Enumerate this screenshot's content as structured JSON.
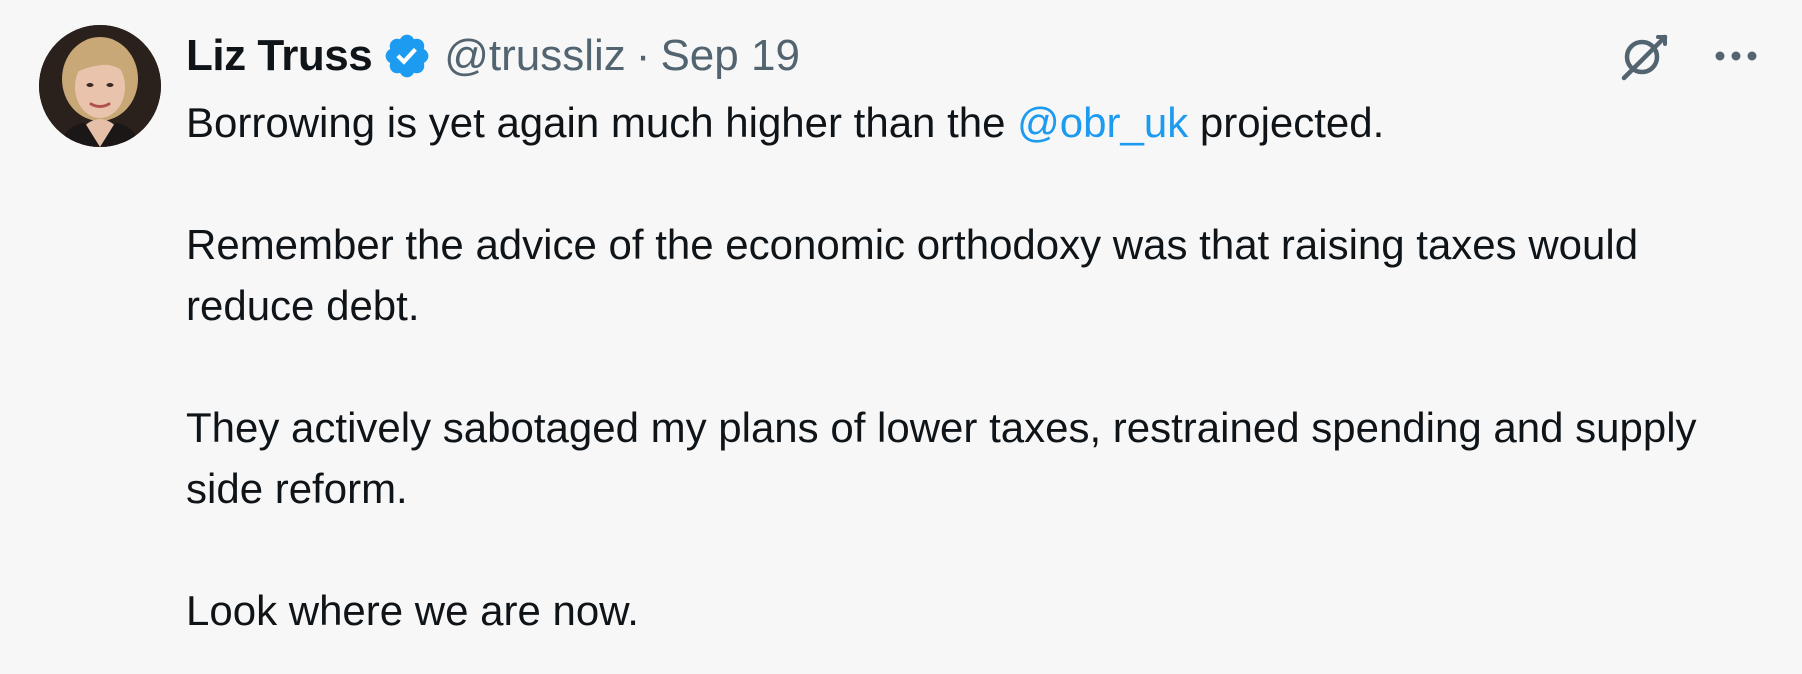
{
  "author": {
    "name": "Liz Truss",
    "handle": "@trussliz",
    "separator": "·",
    "date": "Sep 19",
    "verified": true,
    "verified_color": "#1d9bf0",
    "avatar_icon": "profile-photo"
  },
  "actions": {
    "grok_icon": "grok-icon",
    "more_icon": "more-horizontal-icon"
  },
  "tweet": {
    "line1_before": "Borrowing is yet again much higher than the ",
    "line1_mention": "@obr_uk",
    "line1_after": " projected.",
    "paragraph2": "Remember the advice of the economic orthodoxy was that raising taxes would reduce debt.",
    "paragraph3": "They actively sabotaged my plans of lower taxes, restrained spending and supply side reform.",
    "paragraph4": "Look where we are now."
  },
  "colors": {
    "background": "#f7f7f7",
    "text": "#0f1419",
    "secondary_text": "#536471",
    "link": "#1d9bf0"
  }
}
